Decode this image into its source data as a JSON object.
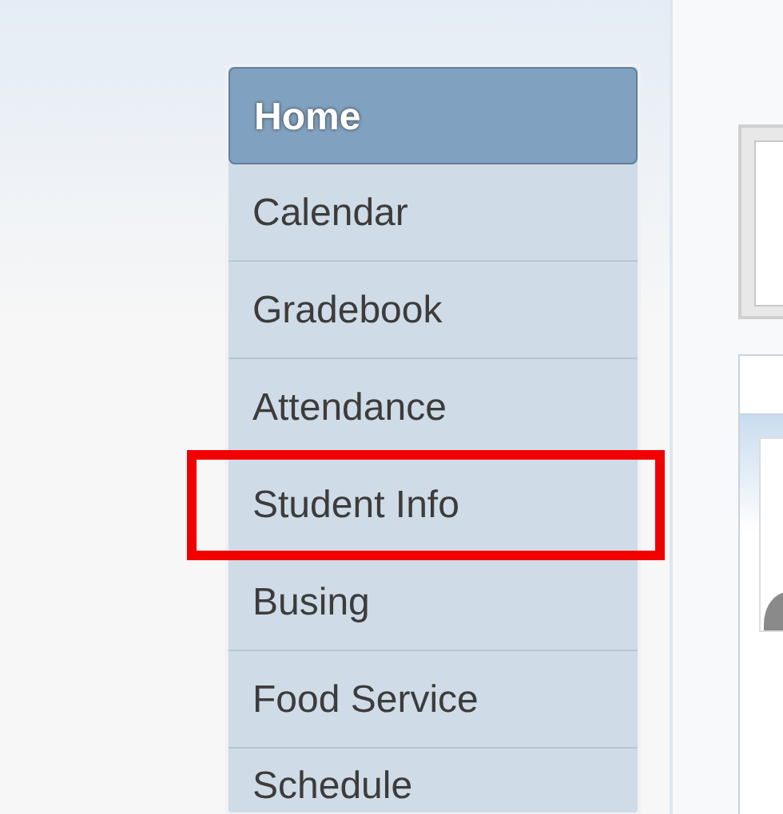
{
  "menu": {
    "items": [
      {
        "label": "Home",
        "selected": true,
        "highlighted": false
      },
      {
        "label": "Calendar",
        "selected": false,
        "highlighted": false
      },
      {
        "label": "Gradebook",
        "selected": false,
        "highlighted": false
      },
      {
        "label": "Attendance",
        "selected": false,
        "highlighted": false
      },
      {
        "label": "Student Info",
        "selected": false,
        "highlighted": true
      },
      {
        "label": "Busing",
        "selected": false,
        "highlighted": false
      },
      {
        "label": "Food Service",
        "selected": false,
        "highlighted": false
      },
      {
        "label": "Schedule",
        "selected": false,
        "highlighted": false
      }
    ]
  }
}
